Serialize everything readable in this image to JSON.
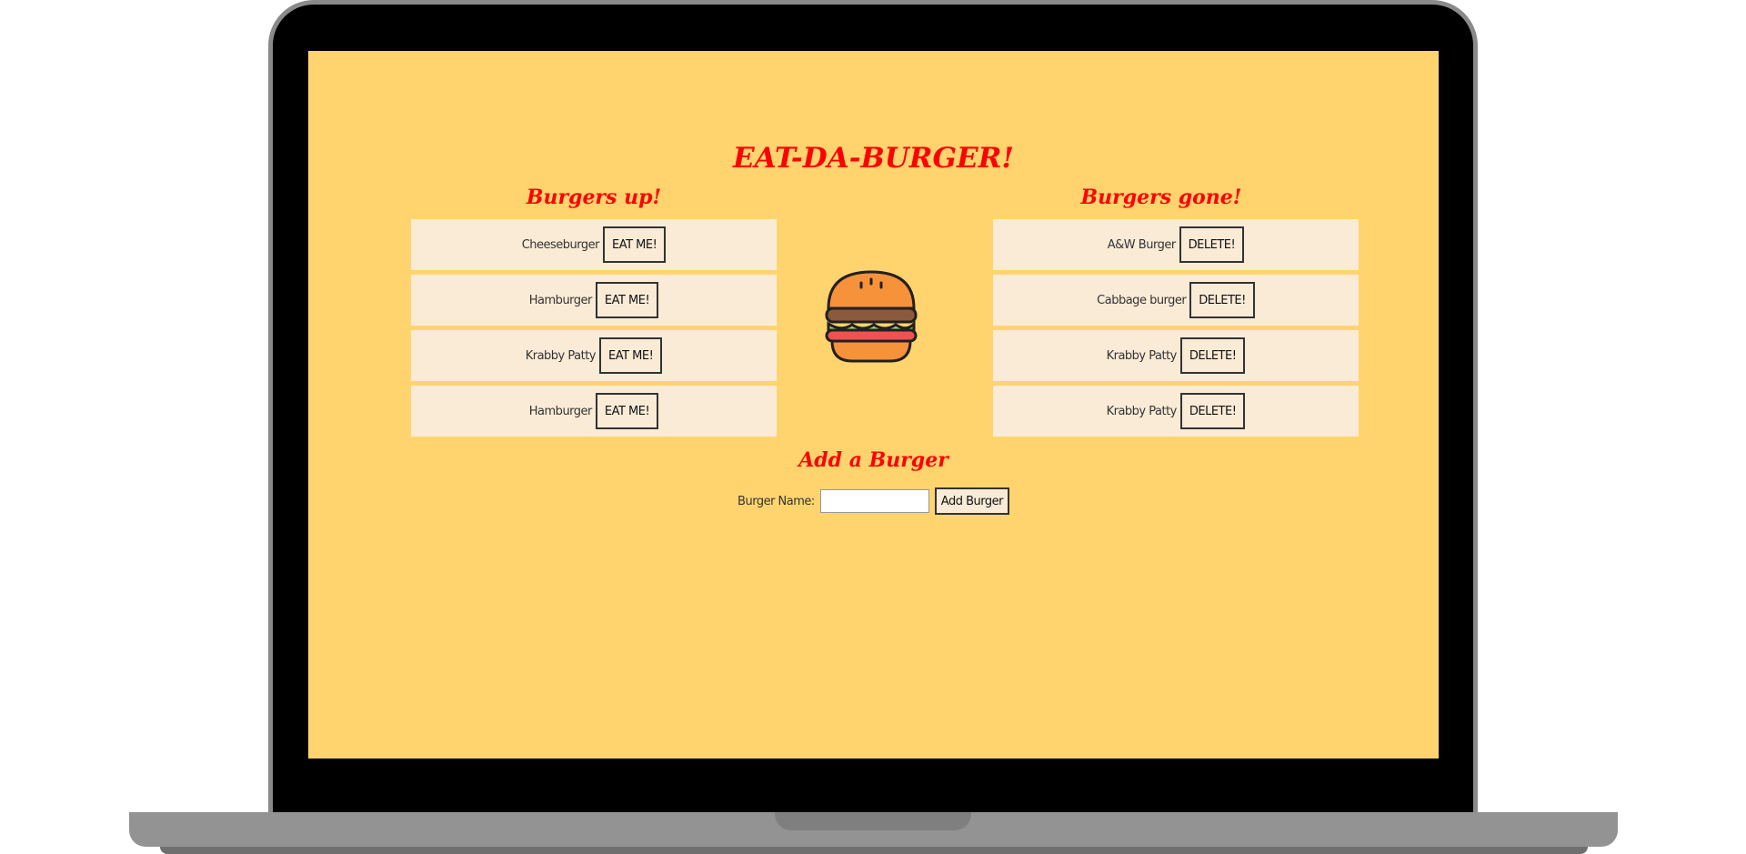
{
  "app": {
    "title": "EAT-DA-BURGER!",
    "colors": {
      "background": "#ffd46e",
      "title": "#ff0000",
      "row": "#faebd7"
    }
  },
  "burgers_up": {
    "title": "Burgers up!",
    "items": [
      {
        "name": "Cheeseburger",
        "action": "EAT ME!"
      },
      {
        "name": "Hamburger",
        "action": "EAT ME!"
      },
      {
        "name": "Krabby Patty",
        "action": "EAT ME!"
      },
      {
        "name": "Hamburger",
        "action": "EAT ME!"
      }
    ]
  },
  "burgers_gone": {
    "title": "Burgers gone!",
    "items": [
      {
        "name": "A&W Burger",
        "action": "DELETE!"
      },
      {
        "name": "Cabbage burger",
        "action": "DELETE!"
      },
      {
        "name": "Krabby Patty",
        "action": "DELETE!"
      },
      {
        "name": "Krabby Patty",
        "action": "DELETE!"
      }
    ]
  },
  "center_icon": "burger-icon",
  "add_form": {
    "title": "Add a Burger",
    "label": "Burger Name:",
    "input_value": "",
    "button_label": "Add Burger"
  }
}
